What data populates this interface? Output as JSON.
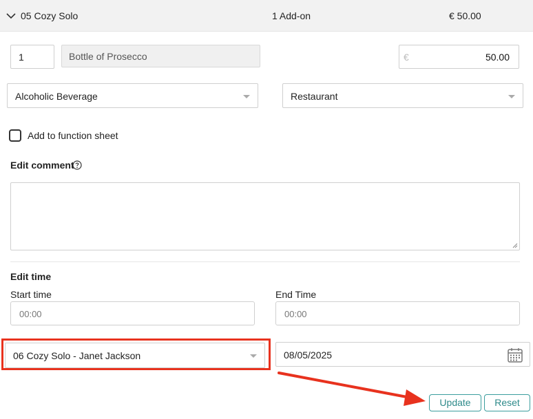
{
  "header": {
    "title": "05 Cozy Solo",
    "addons": "1 Add-on",
    "price": "€ 50.00"
  },
  "item": {
    "quantity": "1",
    "name": "Bottle of Prosecco",
    "currency_symbol": "€",
    "amount": "50.00",
    "category": "Alcoholic Beverage",
    "outlet": "Restaurant"
  },
  "function_sheet": {
    "label": "Add to function sheet",
    "checked": false
  },
  "comment": {
    "label": "Edit comment",
    "value": ""
  },
  "time": {
    "section_label": "Edit time",
    "start_label": "Start time",
    "start_placeholder": "00:00",
    "end_label": "End Time",
    "end_placeholder": "00:00"
  },
  "assignment": {
    "room_guest": "06 Cozy Solo - Janet Jackson",
    "date": "08/05/2025"
  },
  "actions": {
    "update_label": "Update",
    "reset_label": "Reset"
  },
  "colors": {
    "highlight": "#e8321e",
    "accent": "#3a9d9d"
  }
}
